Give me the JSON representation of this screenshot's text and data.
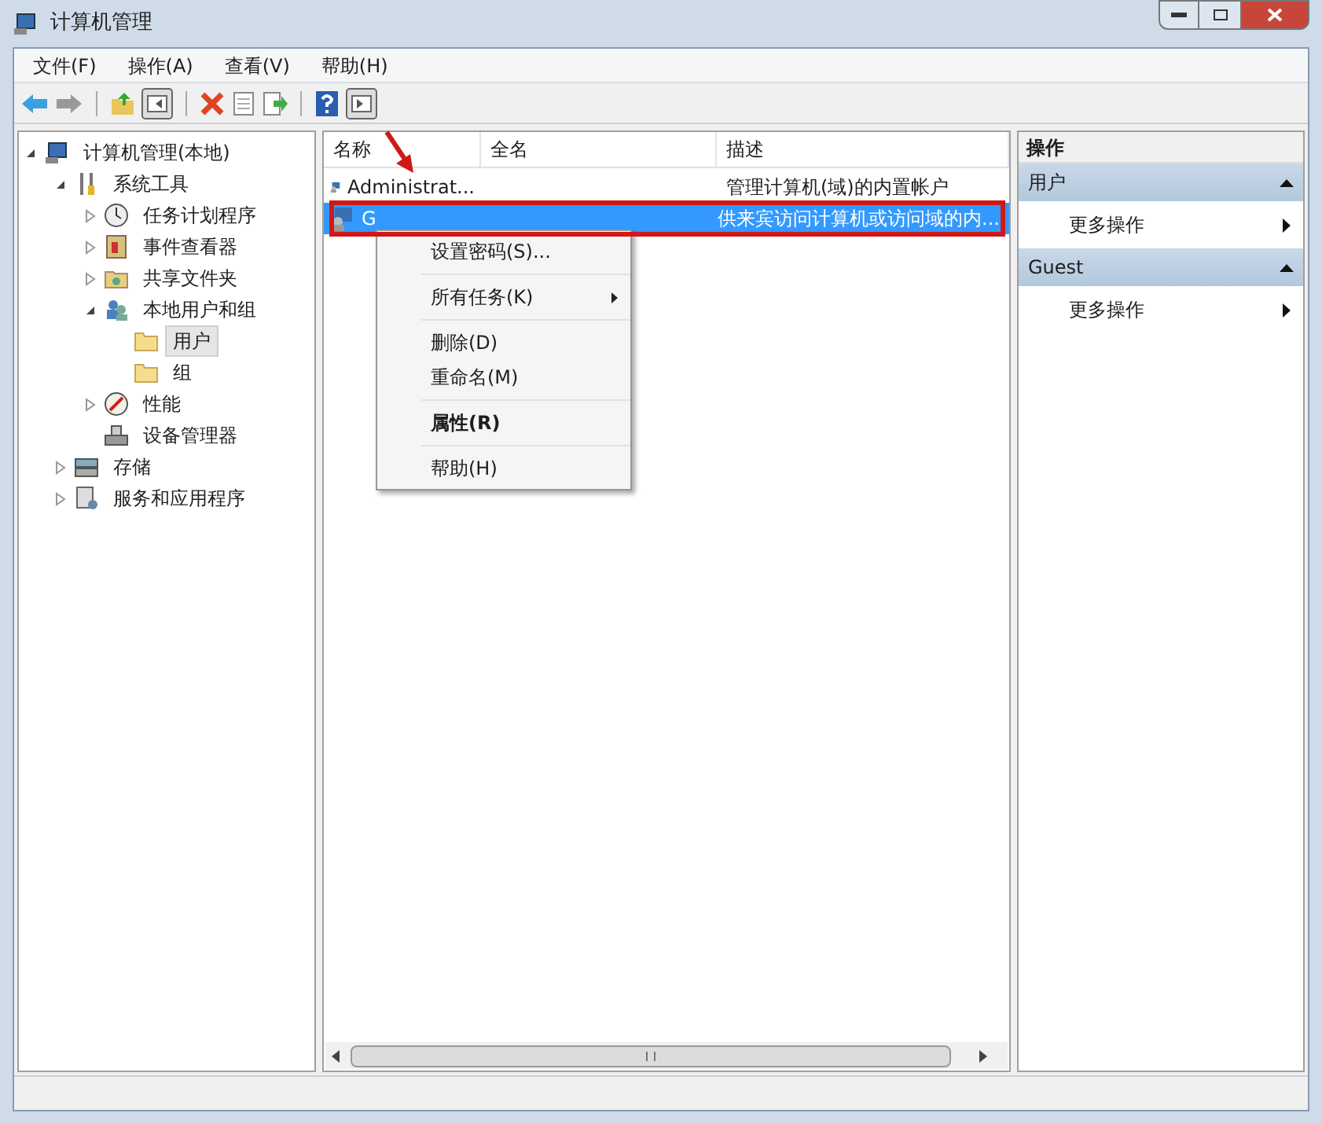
{
  "window": {
    "title": "计算机管理"
  },
  "menu_bar": [
    "文件(F)",
    "操作(A)",
    "查看(V)",
    "帮助(H)"
  ],
  "tree": [
    {
      "label": "计算机管理(本地)",
      "expanded": true,
      "selected": false,
      "children": [
        {
          "label": "系统工具",
          "expanded": true,
          "selected": false,
          "children": [
            {
              "label": "任务计划程序",
              "expanded": false,
              "selected": false
            },
            {
              "label": "事件查看器",
              "expanded": false,
              "selected": false
            },
            {
              "label": "共享文件夹",
              "expanded": false,
              "selected": false
            },
            {
              "label": "本地用户和组",
              "expanded": true,
              "selected": false,
              "children": [
                {
                  "label": "用户",
                  "selected": true
                },
                {
                  "label": "组",
                  "selected": false
                }
              ]
            },
            {
              "label": "性能",
              "expanded": false,
              "selected": false
            },
            {
              "label": "设备管理器",
              "selected": false
            }
          ]
        },
        {
          "label": "存储",
          "expanded": false,
          "selected": false
        },
        {
          "label": "服务和应用程序",
          "expanded": false,
          "selected": false
        }
      ]
    }
  ],
  "table": {
    "columns": [
      "名称",
      "全名",
      "描述"
    ],
    "rows": [
      {
        "name": "Administrat...",
        "description": "管理计算机(域)的内置帐户",
        "selected": false
      },
      {
        "name": "G",
        "description": "供来宾访问计算机或访问域的内...",
        "selected": true
      }
    ]
  },
  "context_menu": {
    "groups": [
      [
        {
          "label": "设置密码(S)...",
          "submenu": false,
          "default": false
        }
      ],
      [
        {
          "label": "所有任务(K)",
          "submenu": true,
          "default": false
        }
      ],
      [
        {
          "label": "删除(D)",
          "submenu": false,
          "default": false
        },
        {
          "label": "重命名(M)",
          "submenu": false,
          "default": false
        }
      ],
      [
        {
          "label": "属性(R)",
          "submenu": false,
          "default": true
        }
      ],
      [
        {
          "label": "帮助(H)",
          "submenu": false,
          "default": false
        }
      ]
    ]
  },
  "actions": {
    "title": "操作",
    "sections": [
      {
        "title": "用户",
        "expanded": true,
        "items": [
          "更多操作"
        ]
      },
      {
        "title": "Guest",
        "expanded": true,
        "items": [
          "更多操作"
        ]
      }
    ]
  }
}
